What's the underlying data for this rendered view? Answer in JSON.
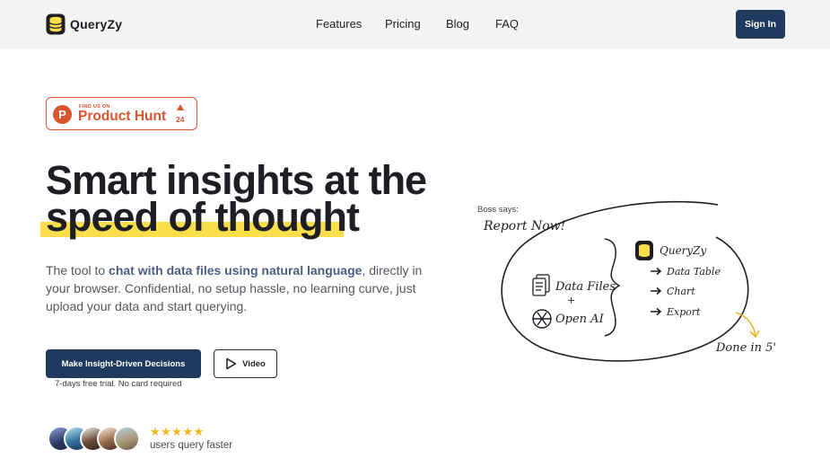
{
  "header": {
    "brand": "QueryZy",
    "nav": [
      "Features",
      "Pricing",
      "Blog",
      "FAQ"
    ],
    "sign_in": "Sign In"
  },
  "badge": {
    "small": "FIND US ON",
    "big": "Product Hunt",
    "count": "24",
    "logo_letter": "P"
  },
  "hero": {
    "line1": "Smart insights at the",
    "line2": "speed of thought",
    "desc_start": "The tool to ",
    "desc_bold": "chat with data files using natural language",
    "desc_end": ", directly in your browser. Confidential, no setup hassle, no learning curve, just upload your data and start querying.",
    "cta": "Make Insight-Driven Decisions",
    "video": "Video",
    "trial": "7-days free trial. No card required"
  },
  "proof": {
    "stars": "★★★★★",
    "text": "users query faster"
  },
  "sketch": {
    "boss": "Boss says:",
    "report": "Report Now!",
    "data_files": "Data Files",
    "plus": "+",
    "open_ai": "Open AI",
    "brand": "QueryZy",
    "items": [
      "Data Table",
      "Chart",
      "Export"
    ],
    "done": "Done in 5'"
  },
  "colors": {
    "primary": "#1e3a5f",
    "highlight": "#fbde4b",
    "product_hunt": "#da552f",
    "star": "#f5b818",
    "header_bg": "#f3f3f3"
  }
}
